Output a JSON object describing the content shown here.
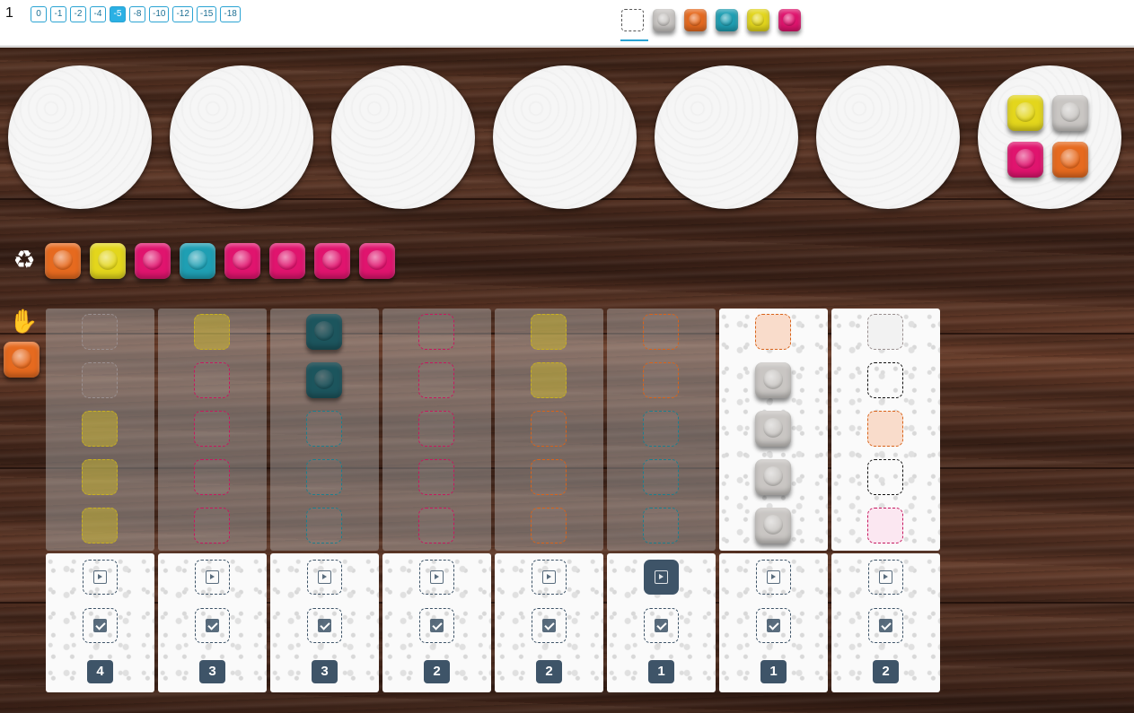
{
  "header": {
    "player_number": "1",
    "score_track": [
      "0",
      "-1",
      "-2",
      "-4",
      "-5",
      "-8",
      "-10",
      "-12",
      "-15",
      "-18"
    ],
    "score_active_index": 4,
    "palette": [
      "empty",
      "grey",
      "orange",
      "teal",
      "yellow",
      "pink"
    ],
    "palette_selected_index": 0
  },
  "colors": {
    "orange": "#e66a1f",
    "yellow": "#e3d61c",
    "pink": "#e0146e",
    "teal": "#1f9fb3",
    "grey": "#c9c6c3",
    "slate": "#3e5468",
    "accent": "#2bb0e4"
  },
  "factories": [
    {
      "tiles": []
    },
    {
      "tiles": []
    },
    {
      "tiles": []
    },
    {
      "tiles": []
    },
    {
      "tiles": []
    },
    {
      "tiles": []
    },
    {
      "tiles": [
        "yellow",
        "grey",
        "pink",
        "orange"
      ]
    }
  ],
  "center": {
    "icon": "recycle-icon",
    "tiles": [
      "orange",
      "yellow",
      "pink",
      "teal",
      "pink",
      "pink",
      "pink",
      "pink"
    ]
  },
  "hand": {
    "icon": "hand-icon",
    "tile": "orange"
  },
  "columns": [
    {
      "state": "filled",
      "rows": [
        {
          "color": "grey",
          "status": "empty"
        },
        {
          "color": "grey",
          "status": "empty"
        },
        {
          "color": "yellow",
          "status": "pattern"
        },
        {
          "color": "yellow",
          "status": "pattern"
        },
        {
          "color": "yellow",
          "status": "pattern"
        }
      ],
      "count": "4",
      "active": false
    },
    {
      "state": "filled",
      "rows": [
        {
          "color": "yellow",
          "status": "pattern"
        },
        {
          "color": "pink",
          "status": "empty"
        },
        {
          "color": "pink",
          "status": "empty"
        },
        {
          "color": "pink",
          "status": "empty"
        },
        {
          "color": "pink",
          "status": "empty"
        }
      ],
      "count": "3",
      "active": false
    },
    {
      "state": "filled",
      "rows": [
        {
          "color": "teal",
          "status": "tile"
        },
        {
          "color": "teal",
          "status": "tile"
        },
        {
          "color": "teal",
          "status": "empty"
        },
        {
          "color": "teal",
          "status": "empty"
        },
        {
          "color": "teal",
          "status": "empty"
        }
      ],
      "count": "3",
      "active": false
    },
    {
      "state": "filled",
      "rows": [
        {
          "color": "pink",
          "status": "empty"
        },
        {
          "color": "pink",
          "status": "empty"
        },
        {
          "color": "pink",
          "status": "empty"
        },
        {
          "color": "pink",
          "status": "empty"
        },
        {
          "color": "pink",
          "status": "empty"
        }
      ],
      "count": "2",
      "active": false
    },
    {
      "state": "filled",
      "rows": [
        {
          "color": "yellow",
          "status": "pattern"
        },
        {
          "color": "yellow",
          "status": "pattern"
        },
        {
          "color": "orange",
          "status": "empty"
        },
        {
          "color": "orange",
          "status": "empty"
        },
        {
          "color": "orange",
          "status": "empty"
        }
      ],
      "count": "2",
      "active": false
    },
    {
      "state": "filled",
      "rows": [
        {
          "color": "orange",
          "status": "empty"
        },
        {
          "color": "orange",
          "status": "empty"
        },
        {
          "color": "teal",
          "status": "empty"
        },
        {
          "color": "teal",
          "status": "empty"
        },
        {
          "color": "teal",
          "status": "empty"
        }
      ],
      "count": "1",
      "active": true
    },
    {
      "state": "open",
      "rows": [
        {
          "color": "orange",
          "status": "target"
        },
        {
          "color": "grey",
          "status": "tile"
        },
        {
          "color": "grey",
          "status": "tile"
        },
        {
          "color": "grey",
          "status": "tile"
        },
        {
          "color": "grey",
          "status": "tile"
        }
      ],
      "count": "1",
      "active": false
    },
    {
      "state": "open",
      "rows": [
        {
          "color": "grey",
          "status": "target"
        },
        {
          "color": "black",
          "status": "target"
        },
        {
          "color": "orange",
          "status": "target"
        },
        {
          "color": "black",
          "status": "target"
        },
        {
          "color": "pink",
          "status": "target"
        }
      ],
      "count": "2",
      "active": false
    }
  ]
}
